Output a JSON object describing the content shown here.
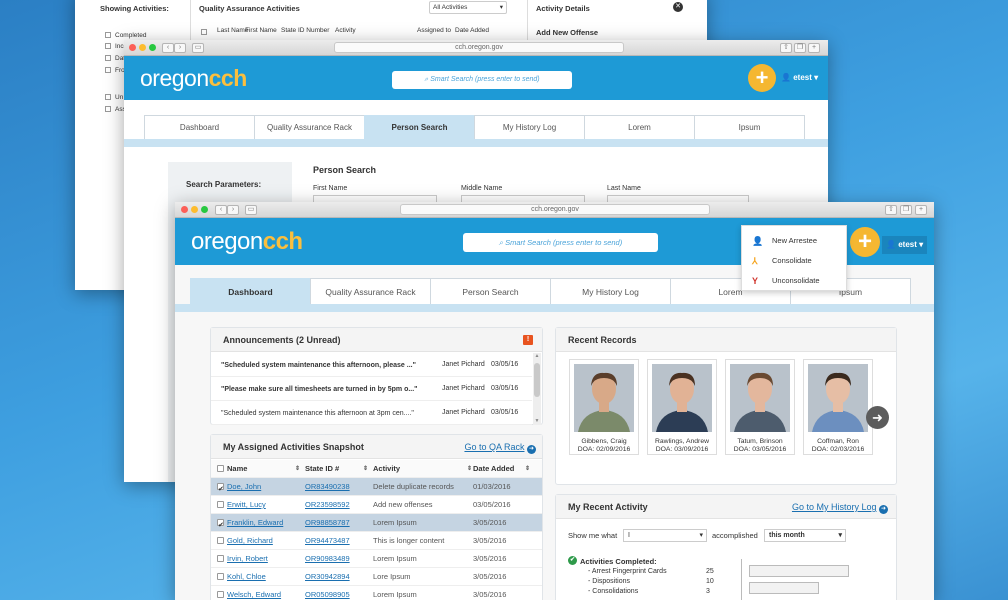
{
  "back_window": {
    "showing_label": "Showing Activities:",
    "filter_items": [
      "Completed",
      "Incomplete",
      "Dat",
      "Fro",
      "Un",
      "Ass"
    ],
    "qa_title": "Quality Assurance Activities",
    "qa_select": "All Activities",
    "qa_columns": [
      "Last Name",
      "First Name",
      "State ID Number",
      "Activity",
      "Assigned to",
      "Date Added"
    ],
    "details_title": "Activity Details",
    "add_offense": "Add New Offense"
  },
  "mid_window": {
    "url": "cch.oregon.gov",
    "logo_prefix": "oregon",
    "logo_suffix": "cch",
    "search_placeholder": "Smart Search (press enter to send)",
    "user": "etest",
    "tabs": [
      "Dashboard",
      "Quality Assurance Rack",
      "Person Search",
      "My History Log",
      "Lorem",
      "Ipsum"
    ],
    "active_tab": "Person Search",
    "search_params_label": "Search Parameters:",
    "person_search_title": "Person Search",
    "fields": [
      "First Name",
      "Middle Name",
      "Last Name"
    ]
  },
  "front_window": {
    "url": "cch.oregon.gov",
    "logo_prefix": "oregon",
    "logo_suffix": "cch",
    "search_placeholder": "Smart Search (press enter to send)",
    "user": "etest",
    "menu": [
      {
        "label": "New Arrestee",
        "icon": "add-user-icon",
        "color": "#2e9a4a"
      },
      {
        "label": "Consolidate",
        "icon": "merge-icon",
        "color": "#f5a623"
      },
      {
        "label": "Unconsolidate",
        "icon": "split-icon",
        "color": "#d0342c"
      }
    ],
    "tabs": [
      "Dashboard",
      "Quality Assurance Rack",
      "Person Search",
      "My History Log",
      "Lorem",
      "Ipsum"
    ],
    "active_tab": "Dashboard",
    "announcements": {
      "title": "Announcements (2 Unread)",
      "badge": "!",
      "items": [
        {
          "text": "\"Scheduled system maintenance this afternoon, please ...\"",
          "author": "Janet Pichard",
          "date": "03/05/16",
          "unread": true
        },
        {
          "text": "\"Please make sure all timesheets are turned in by 5pm o...\"",
          "author": "Janet Pichard",
          "date": "03/05/16",
          "unread": true
        },
        {
          "text": "\"Scheduled system maintenance this afternoon at 3pm cen....\"",
          "author": "Janet Pichard",
          "date": "03/05/16",
          "unread": false
        }
      ]
    },
    "activities": {
      "title": "My Assigned Activities Snapshot",
      "link": "Go to QA Rack",
      "columns": [
        "Name",
        "State ID #",
        "Activity",
        "Date Added"
      ],
      "rows": [
        {
          "name": "Doe, John",
          "sid": "OR83490238",
          "activity": "Delete duplicate records",
          "date": "01/03/2016",
          "checked": true
        },
        {
          "name": "Erwitt, Lucy",
          "sid": "OR23598592",
          "activity": "Add new offenses",
          "date": "03/05/2016",
          "checked": false
        },
        {
          "name": "Franklin, Edward",
          "sid": "OR98858787",
          "activity": "Lorem Ipsum",
          "date": "3/05/2016",
          "checked": true
        },
        {
          "name": "Gold, Richard",
          "sid": "OR94473487",
          "activity": "This is longer content",
          "date": "3/05/2016",
          "checked": false
        },
        {
          "name": "Irvin, Robert",
          "sid": "OR90983489",
          "activity": "Lorem Ipsum",
          "date": "3/05/2016",
          "checked": false
        },
        {
          "name": "Kohl, Chloe",
          "sid": "OR30942894",
          "activity": "Lore Ipsum",
          "date": "3/05/2016",
          "checked": false
        },
        {
          "name": "Welsch, Edward",
          "sid": "OR05098905",
          "activity": "Lorem Ipsum",
          "date": "3/05/2016",
          "checked": false
        }
      ]
    },
    "recent_records": {
      "title": "Recent Records",
      "people": [
        {
          "name": "Gibbens, Craig",
          "doa": "DOA: 02/09/2016",
          "shirt": "#7b8a6a",
          "skin": "#d8a988",
          "hair": "#5a3e2b"
        },
        {
          "name": "Rawlings, Andrew",
          "doa": "DOA: 03/09/2016",
          "shirt": "#2c3d55",
          "skin": "#e1b295",
          "hair": "#4a3121"
        },
        {
          "name": "Tatum, Brinson",
          "doa": "DOA: 03/05/2016",
          "shirt": "#4d5c6d",
          "skin": "#e3b79d",
          "hair": "#6a4a32"
        },
        {
          "name": "Coffman, Ron",
          "doa": "DOA: 02/03/2016",
          "shirt": "#6c8fbf",
          "skin": "#e6bea5",
          "hair": "#3b2a1e"
        }
      ]
    },
    "recent_activity": {
      "title": "My Recent Activity",
      "link": "Go to My History Log",
      "show_me_label": "Show me what",
      "show_me_value": "I",
      "accomplished_label": "accomplished",
      "period_value": "this month",
      "completed_label": "Activities Completed:",
      "items": [
        {
          "label": "- Arrest Fingerprint Cards",
          "count": "25"
        },
        {
          "label": "- Dispositions",
          "count": "10"
        },
        {
          "label": "- Consolidations",
          "count": "3"
        }
      ]
    }
  }
}
